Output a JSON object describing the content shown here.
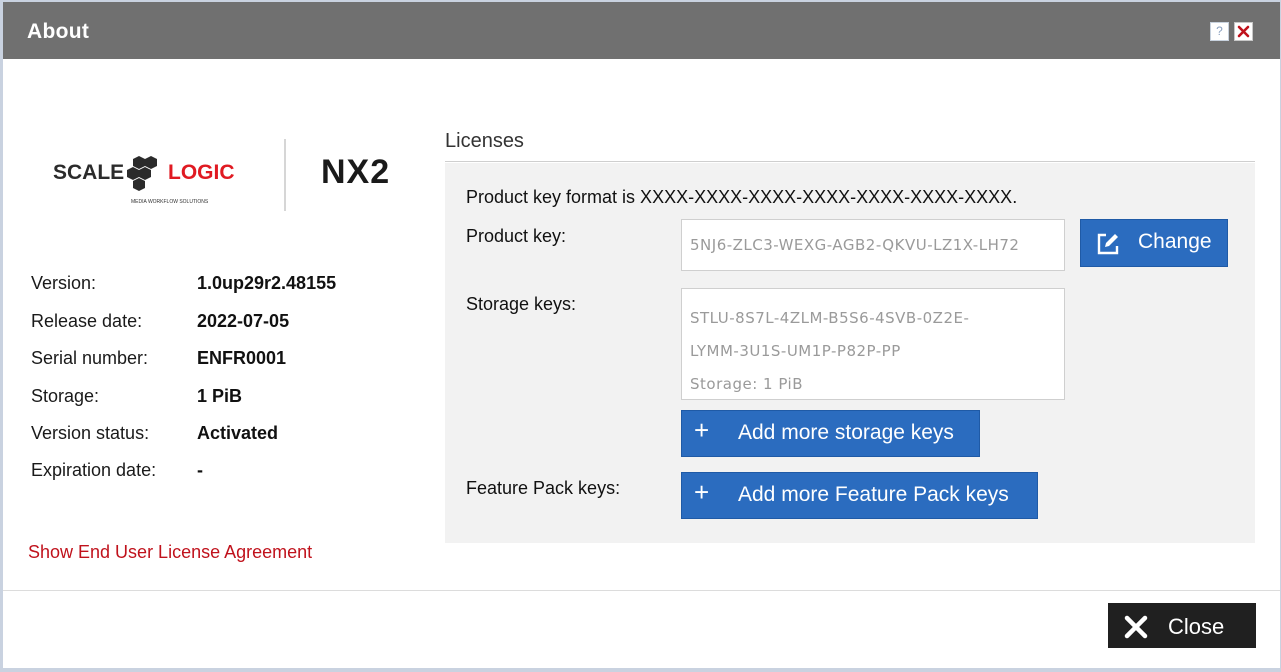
{
  "dialog": {
    "title": "About",
    "help_label": "?",
    "icons": {
      "help": "help-icon",
      "close": "close-icon"
    }
  },
  "branding": {
    "logo_text_left": "SCALE",
    "logo_text_right": "LOGIC",
    "logo_tagline": "MEDIA WORKFLOW SOLUTIONS",
    "product": "NX2",
    "colors": {
      "logo_dark": "#2b2b2b",
      "logo_red": "#e01a22"
    }
  },
  "info": [
    {
      "label": "Version:",
      "value": "1.0up29r2.48155"
    },
    {
      "label": "Release date:",
      "value": "2022-07-05"
    },
    {
      "label": "Serial number:",
      "value": "ENFR0001"
    },
    {
      "label": "Storage:",
      "value": "1 PiB"
    },
    {
      "label": "Version status:",
      "value": "Activated"
    },
    {
      "label": "Expiration date:",
      "value": "-"
    }
  ],
  "eula_link": "Show End User License Agreement",
  "licenses": {
    "header": "Licenses",
    "format_text": "Product key format is XXXX-XXXX-XXXX-XXXX-XXXX-XXXX-XXXX.",
    "product_key_label": "Product key:",
    "product_key_value": "5NJ6-ZLC3-WEXG-AGB2-QKVU-LZ1X-LH72",
    "change_button": "Change",
    "storage_keys_label": "Storage keys:",
    "storage_keys_lines": [
      "STLU-8S7L-4ZLM-B5S6-4SVB-0Z2E-",
      "LYMM-3U1S-UM1P-P82P-PP",
      "Storage: 1 PiB"
    ],
    "add_storage_button": "Add more storage keys",
    "feature_pack_label": "Feature Pack keys:",
    "add_feature_button": "Add more Feature Pack keys",
    "plus": "+",
    "colors": {
      "button_blue": "#2b6cbf"
    }
  },
  "footer": {
    "close_button": "Close",
    "colors": {
      "close_bg": "#202020"
    }
  }
}
